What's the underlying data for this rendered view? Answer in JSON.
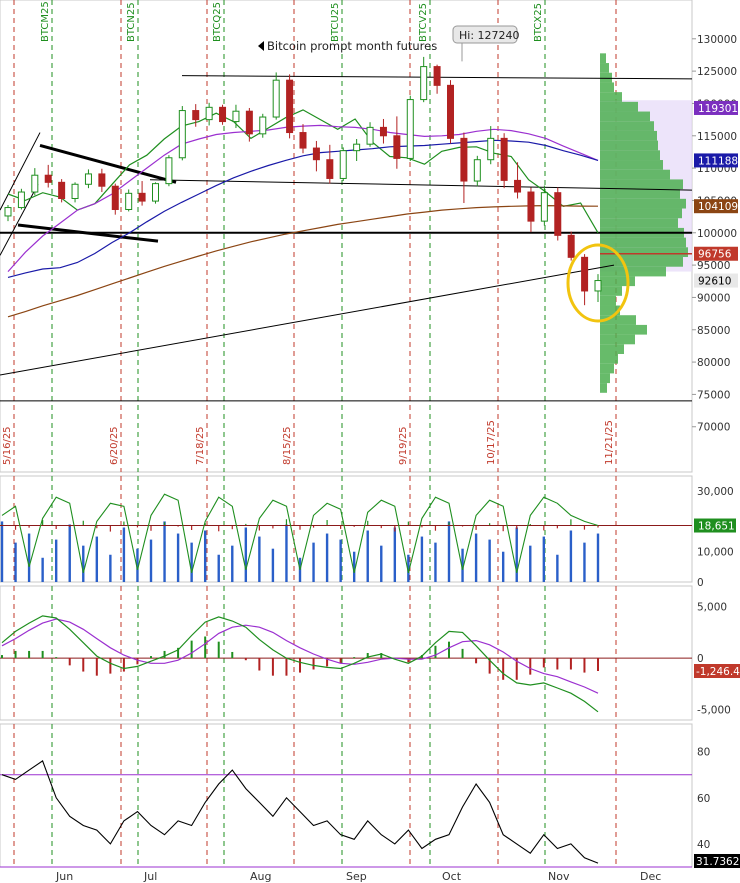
{
  "chart_data": {
    "type": "candlestick",
    "title": "Bitcoin prompt month futures",
    "hi_label": "Hi: 127240",
    "price_panel": {
      "ylim": [
        63000,
        136000
      ],
      "ticks": [
        "130000",
        "125000",
        "120000",
        "115000",
        "110000",
        "105000",
        "100000",
        "95000",
        "90000",
        "85000",
        "80000",
        "75000",
        "70000"
      ],
      "tags": [
        {
          "label": "119301",
          "value": 119301,
          "color": "#7b2fbf",
          "text": "#ffffff"
        },
        {
          "label": "111188",
          "value": 111188,
          "color": "#1a1aa8",
          "text": "#ffffff"
        },
        {
          "label": "104109",
          "value": 104109,
          "color": "#8b4513",
          "text": "#ffffff"
        },
        {
          "label": "96756",
          "value": 96756,
          "color": "#c0392b",
          "text": "#ffffff"
        },
        {
          "label": "92610",
          "value": 92610,
          "color": "#e8e8e8",
          "text": "#000000"
        }
      ],
      "horizontal_lines": [
        {
          "name": "top-resistance",
          "y1": 124300,
          "y2": 123800,
          "color": "#000000",
          "width": 1
        },
        {
          "name": "mid-resistance",
          "y1": 108200,
          "y2": 106600,
          "color": "#000000",
          "width": 1
        },
        {
          "name": "support-100k",
          "y1": 100000,
          "y2": 100000,
          "color": "#000000",
          "width": 2
        },
        {
          "name": "bottom-line",
          "y1": 74000,
          "y2": 74000,
          "color": "#000000",
          "width": 1
        }
      ],
      "trendline": {
        "y_start": 78000,
        "y_end": 95000
      },
      "wedge_upper": {
        "y1": 113500,
        "y2": 107800
      },
      "wedge_lower": {
        "y1": 101200,
        "y2": 98700
      },
      "highlight": "gold-circle",
      "series": [
        {
          "name": "",
          "color": "#1f8f1f",
          "values": [
            106000,
            105000,
            106200,
            105500,
            103500,
            104500,
            107500,
            110500,
            112000,
            114500,
            116500,
            117200,
            118500,
            117200,
            114600,
            116200,
            117800,
            119000,
            117500,
            116000,
            117600,
            114000,
            111800,
            111600,
            110600,
            112600,
            113200,
            113300,
            112300,
            111800,
            108200,
            106300,
            104100,
            104600,
            100000
          ]
        },
        {
          "name": "",
          "color": "#9b30d0",
          "values": [
            94000,
            97000,
            99500,
            101500,
            103500,
            104500,
            106000,
            108000,
            110000,
            112000,
            113700,
            114500,
            115200,
            115500,
            115700,
            115900,
            116300,
            116500,
            116600,
            116400,
            116300,
            116000,
            115500,
            115200,
            114900,
            115000,
            115200,
            115700,
            116000,
            115800,
            115300,
            114600,
            113400,
            112300,
            111200
          ]
        },
        {
          "name": "",
          "color": "#1a1aa8",
          "values": [
            93100,
            93800,
            94400,
            94600,
            95400,
            96800,
            98500,
            100000,
            101700,
            103300,
            104700,
            106000,
            107300,
            108500,
            109500,
            110400,
            111200,
            111900,
            112400,
            112600,
            112800,
            113000,
            113300,
            113400,
            113500,
            113700,
            113900,
            114100,
            114300,
            114200,
            114000,
            113500,
            112700,
            112000,
            111200
          ]
        },
        {
          "name": "",
          "color": "#8b4513",
          "values": [
            87000,
            87800,
            88700,
            89500,
            90300,
            91200,
            92100,
            93000,
            93900,
            94800,
            95600,
            96400,
            97200,
            97900,
            98600,
            99200,
            99800,
            100300,
            100800,
            101300,
            101700,
            102100,
            102500,
            102900,
            103200,
            103500,
            103700,
            103900,
            104000,
            104100,
            104150,
            104200,
            104150,
            104120,
            104109
          ]
        }
      ],
      "candles": [
        [
          102600,
          104300,
          101800,
          103900
        ],
        [
          103900,
          106800,
          103600,
          106300
        ],
        [
          106300,
          110000,
          105800,
          108900
        ],
        [
          108900,
          110500,
          107000,
          107800
        ],
        [
          107800,
          108300,
          104700,
          105300
        ],
        [
          105300,
          107800,
          104700,
          107500
        ],
        [
          107500,
          109800,
          106900,
          109100
        ],
        [
          109100,
          109900,
          106300,
          107200
        ],
        [
          107200,
          107600,
          102800,
          103600
        ],
        [
          103600,
          106700,
          103300,
          106100
        ],
        [
          106100,
          108000,
          104200,
          104900
        ],
        [
          104900,
          107800,
          104500,
          107600
        ],
        [
          107600,
          112000,
          107200,
          111600
        ],
        [
          111600,
          119600,
          111200,
          118900
        ],
        [
          118900,
          119900,
          116400,
          117500
        ],
        [
          117500,
          120100,
          116600,
          119400
        ],
        [
          119400,
          119800,
          116700,
          117200
        ],
        [
          117200,
          119800,
          116200,
          118800
        ],
        [
          118800,
          119300,
          114100,
          115300
        ],
        [
          115300,
          118400,
          114700,
          117900
        ],
        [
          117900,
          124800,
          117500,
          123600
        ],
        [
          123600,
          124500,
          114600,
          115500
        ],
        [
          115500,
          116800,
          112300,
          113100
        ],
        [
          113100,
          114200,
          109500,
          111300
        ],
        [
          111300,
          113600,
          107600,
          108400
        ],
        [
          108400,
          113200,
          108000,
          112700
        ],
        [
          112700,
          114500,
          111100,
          113700
        ],
        [
          113700,
          117100,
          113300,
          116300
        ],
        [
          116300,
          117600,
          113800,
          115000
        ],
        [
          115000,
          118000,
          109900,
          111500
        ],
        [
          111500,
          121200,
          111100,
          120600
        ],
        [
          120600,
          127200,
          120200,
          125700
        ],
        [
          125700,
          126000,
          121500,
          122800
        ],
        [
          122800,
          123600,
          113800,
          114600
        ],
        [
          114600,
          115500,
          104600,
          108000
        ],
        [
          108000,
          111900,
          107200,
          111300
        ],
        [
          111300,
          116500,
          110600,
          114600
        ],
        [
          114600,
          115400,
          106900,
          108100
        ],
        [
          108100,
          110900,
          105300,
          106300
        ],
        [
          106300,
          107000,
          100100,
          101800
        ],
        [
          101800,
          107300,
          101100,
          106200
        ],
        [
          106200,
          107000,
          98800,
          99600
        ],
        [
          99600,
          100200,
          95700,
          96200
        ],
        [
          96200,
          96700,
          88800,
          91000
        ],
        [
          91000,
          93600,
          89300,
          92610
        ]
      ],
      "volume_profile": [
        {
          "p": 127000,
          "w": 6
        },
        {
          "p": 125500,
          "w": 9
        },
        {
          "p": 124000,
          "w": 12
        },
        {
          "p": 122500,
          "w": 14
        },
        {
          "p": 121000,
          "w": 22
        },
        {
          "p": 119500,
          "w": 38
        },
        {
          "p": 118000,
          "w": 50
        },
        {
          "p": 116500,
          "w": 54
        },
        {
          "p": 115000,
          "w": 57
        },
        {
          "p": 113500,
          "w": 58
        },
        {
          "p": 112000,
          "w": 60
        },
        {
          "p": 110500,
          "w": 63
        },
        {
          "p": 109000,
          "w": 70
        },
        {
          "p": 107500,
          "w": 83
        },
        {
          "p": 106000,
          "w": 80
        },
        {
          "p": 104500,
          "w": 86
        },
        {
          "p": 103000,
          "w": 82
        },
        {
          "p": 101500,
          "w": 78
        },
        {
          "p": 100000,
          "w": 84
        },
        {
          "p": 98500,
          "w": 86
        },
        {
          "p": 97000,
          "w": 88
        },
        {
          "p": 95500,
          "w": 83
        },
        {
          "p": 94000,
          "w": 66
        },
        {
          "p": 92500,
          "w": 35
        },
        {
          "p": 91000,
          "w": 22
        },
        {
          "p": 89500,
          "w": 16
        },
        {
          "p": 88000,
          "w": 20
        },
        {
          "p": 86500,
          "w": 36
        },
        {
          "p": 85000,
          "w": 47
        },
        {
          "p": 83500,
          "w": 35
        },
        {
          "p": 82000,
          "w": 24
        },
        {
          "p": 80500,
          "w": 18
        },
        {
          "p": 79000,
          "w": 14
        },
        {
          "p": 77500,
          "w": 10
        },
        {
          "p": 76000,
          "w": 7
        }
      ]
    },
    "contract_labels": [
      "BTCM25",
      "BTCN25",
      "BTCQ25",
      "BTCU25",
      "BTCV25",
      "BTCX25"
    ],
    "date_labels": [
      "5/16/25",
      "6/20/25",
      "7/18/25",
      "8/15/25",
      "9/19/25",
      "10/17/25",
      "11/21/25"
    ],
    "x_axis": [
      "Jun",
      "Jul",
      "Aug",
      "Sep",
      "Oct",
      "Nov",
      "Dec"
    ],
    "oi_panel": {
      "ylim": [
        0,
        35000
      ],
      "ticks": [
        "30,000",
        "10,000",
        "0"
      ],
      "tag": {
        "label": "18,651",
        "value": 18651,
        "color": "#1f8f1f"
      },
      "ref_level": 18651,
      "volume": [
        20000,
        13000,
        16000,
        8000,
        14000,
        19000,
        12000,
        15000,
        9000,
        18000,
        11000,
        14000,
        20000,
        16000,
        13000,
        17000,
        9000,
        12000,
        18000,
        15000,
        11000,
        19000,
        8000,
        13000,
        16000,
        14000,
        10000,
        17000,
        12000,
        18000,
        9000,
        15000,
        13000,
        20000,
        11000,
        16000,
        14000,
        10000,
        18000,
        12000,
        15000,
        9000,
        17000,
        13000,
        16000
      ],
      "oi": [
        22000,
        25000,
        5000,
        21000,
        28000,
        26000,
        3000,
        20000,
        26000,
        25000,
        4000,
        22000,
        29000,
        27000,
        3000,
        20000,
        28000,
        25000,
        4000,
        21000,
        27000,
        25000,
        4000,
        22000,
        26000,
        24000,
        3000,
        23000,
        27000,
        25000,
        3000,
        21000,
        28000,
        26000,
        4000,
        22000,
        27000,
        25000,
        3000,
        22000,
        28000,
        26000,
        22000,
        20000,
        18651
      ]
    },
    "macd_panel": {
      "ylim": [
        -6000,
        7000
      ],
      "ticks": [
        "5,000",
        "0",
        "-5,000"
      ],
      "tag": {
        "label": "-1,246.4",
        "value": -1246.4,
        "color": "#c0392b"
      },
      "macd": [
        1500,
        2600,
        3400,
        4100,
        3900,
        2800,
        1500,
        200,
        -500,
        -1000,
        -800,
        -300,
        200,
        800,
        2200,
        3500,
        4000,
        3600,
        3000,
        1800,
        800,
        0,
        -400,
        -700,
        -900,
        -1000,
        -500,
        100,
        400,
        -100,
        -500,
        200,
        1500,
        2600,
        2500,
        1200,
        -200,
        -1500,
        -2400,
        -2600,
        -2400,
        -2900,
        -3400,
        -4200,
        -5200
      ],
      "signal": [
        1200,
        1900,
        2700,
        3400,
        3800,
        3500,
        2800,
        1900,
        1000,
        300,
        -200,
        -500,
        -500,
        -200,
        500,
        1400,
        2400,
        3000,
        3200,
        3000,
        2500,
        1700,
        1000,
        400,
        -100,
        -500,
        -600,
        -400,
        -100,
        0,
        -100,
        -100,
        300,
        1000,
        1600,
        1700,
        1300,
        600,
        -300,
        -1000,
        -1500,
        -1800,
        -2300,
        -2800,
        -3400
      ],
      "hist": [
        300,
        700,
        700,
        700,
        100,
        -700,
        -1300,
        -1700,
        -1500,
        -1300,
        -600,
        200,
        700,
        1000,
        1700,
        2100,
        1600,
        600,
        -200,
        -1200,
        -1700,
        -1700,
        -1400,
        -1100,
        -800,
        -500,
        100,
        500,
        500,
        -100,
        -400,
        300,
        1200,
        1600,
        900,
        -500,
        -1500,
        -2100,
        -2100,
        -1600,
        -900,
        -1100,
        -1100,
        -1400,
        -1246
      ]
    },
    "rsi_panel": {
      "ylim": [
        30,
        92
      ],
      "ticks": [
        "80",
        "60",
        "40"
      ],
      "tag": {
        "label": "31.7362",
        "value": 31.7362,
        "color": "#000000"
      },
      "upper": 70,
      "lower": 30,
      "values": [
        70,
        68,
        72,
        76,
        60,
        52,
        48,
        46,
        40,
        50,
        54,
        48,
        44,
        50,
        48,
        58,
        66,
        72,
        64,
        58,
        52,
        60,
        54,
        48,
        50,
        44,
        42,
        50,
        44,
        40,
        46,
        38,
        42,
        44,
        56,
        66,
        58,
        44,
        40,
        36,
        44,
        38,
        40,
        34,
        31.7
      ]
    }
  }
}
